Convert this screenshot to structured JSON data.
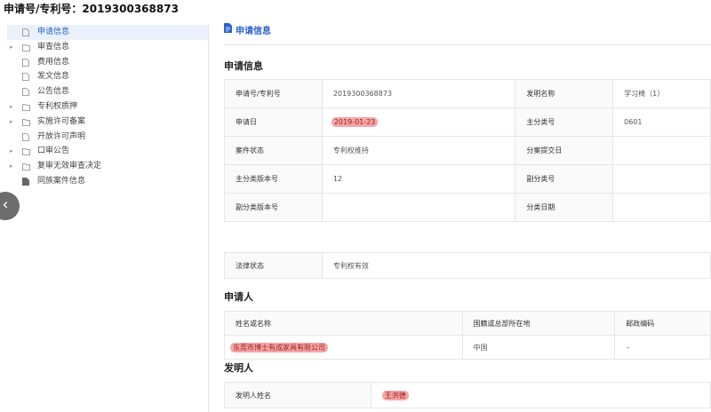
{
  "header": {
    "title": "申请号/专利号：2019300368873"
  },
  "sidebar": {
    "items": [
      {
        "label": "申请信息",
        "icon": "document-icon",
        "expandable": false,
        "active": true
      },
      {
        "label": "审查信息",
        "icon": "folder-icon",
        "expandable": true,
        "active": false
      },
      {
        "label": "费用信息",
        "icon": "document-icon",
        "expandable": false,
        "active": false
      },
      {
        "label": "发文信息",
        "icon": "document-icon",
        "expandable": false,
        "active": false
      },
      {
        "label": "公告信息",
        "icon": "document-icon",
        "expandable": false,
        "active": false
      },
      {
        "label": "专利权质押",
        "icon": "folder-icon",
        "expandable": true,
        "active": false
      },
      {
        "label": "实施许可备案",
        "icon": "folder-icon",
        "expandable": true,
        "active": false
      },
      {
        "label": "开放许可声明",
        "icon": "document-icon",
        "expandable": false,
        "active": false
      },
      {
        "label": "口审公告",
        "icon": "folder-icon",
        "expandable": true,
        "active": false
      },
      {
        "label": "复审无效审查决定",
        "icon": "folder-icon",
        "expandable": true,
        "active": false
      },
      {
        "label": "同族案件信息",
        "icon": "document-filled-icon",
        "expandable": false,
        "active": false
      }
    ]
  },
  "panel": {
    "title": "申请信息"
  },
  "application": {
    "section_title": "申请信息",
    "rows": [
      {
        "k1": "申请号/专利号",
        "v1": "2019300368873",
        "k2": "发明名称",
        "v2": "学习椅（1）"
      },
      {
        "k1": "申请日",
        "v1": "2019-01-23",
        "k2": "主分类号",
        "v2": "0601"
      },
      {
        "k1": "案件状态",
        "v1": "专利权维持",
        "k2": "分案提交日",
        "v2": ""
      },
      {
        "k1": "主分类版本号",
        "v1": "12",
        "k2": "副分类号",
        "v2": ""
      },
      {
        "k1": "副分类版本号",
        "v1": "",
        "k2": "分类日期",
        "v2": ""
      }
    ],
    "legal_status_label": "法律状态",
    "legal_status_value": "专利权有效"
  },
  "applicant": {
    "section_title": "申请人",
    "headers": [
      "姓名或名称",
      "国籍或总部所在地",
      "邮政编码"
    ],
    "row": [
      "东莞市博士有成家具有限公司",
      "中国",
      "–"
    ]
  },
  "inventor": {
    "section_title": "发明人",
    "label": "发明人姓名",
    "value": "王洪德"
  },
  "colors": {
    "accent": "#2a62c9",
    "highlight": "#f4a7a7"
  }
}
